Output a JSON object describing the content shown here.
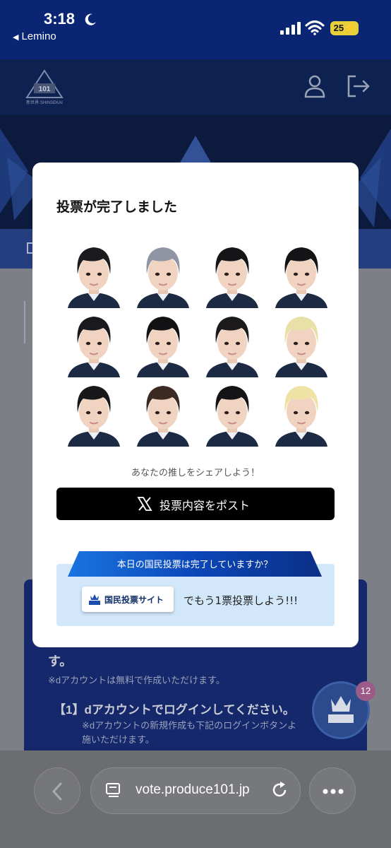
{
  "status_bar": {
    "time": "3:18",
    "back_app": "Lemino",
    "battery": "25"
  },
  "background_page": {
    "text_1": "す。",
    "text_2": "※dアカウントは無料で作成いただけます。",
    "text_3": "【1】dアカウントでログインしてください。",
    "text_4": "※dアカウントの新規作成も下記のログインボタンよ",
    "text_5": "施いただけます。",
    "fab_badge": "12"
  },
  "modal": {
    "title": "投票が完了しました",
    "trainees": [
      {
        "hair": "#1b1b1f"
      },
      {
        "hair": "#8f95a3"
      },
      {
        "hair": "#151518"
      },
      {
        "hair": "#141416"
      },
      {
        "hair": "#1a1a1e"
      },
      {
        "hair": "#121214"
      },
      {
        "hair": "#1c1a1b"
      },
      {
        "hair": "#e9e0a7"
      },
      {
        "hair": "#18181b"
      },
      {
        "hair": "#3a2a22"
      },
      {
        "hair": "#141417"
      },
      {
        "hair": "#eee2a4"
      }
    ],
    "share_caption": "あなたの推しをシェアしよう！",
    "post_button": "投票内容をポスト",
    "vote_banner": "本日の国民投票は完了していますか？",
    "vote_site_button": "国民投票サイト",
    "vote_cta": "でもう1票投票しよう!!!"
  },
  "browser": {
    "url": "vote.produce101.jp"
  },
  "colors": {
    "header": "#0a2574",
    "post_button_bg": "#000000",
    "vote_box_bg": "#d3e7fb",
    "ribbon": "#1257c6"
  }
}
